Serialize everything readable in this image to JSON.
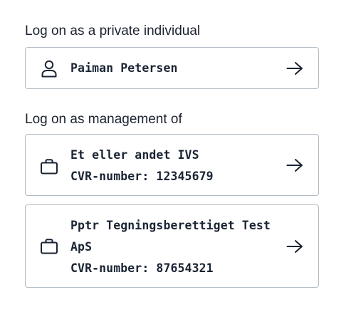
{
  "private_section": {
    "heading": "Log on as a private individual",
    "person": {
      "name": "Paiman Petersen",
      "icon": "person-icon"
    }
  },
  "management_section": {
    "heading": "Log on as management of",
    "companies": [
      {
        "name": "Et eller andet IVS",
        "cvr": "CVR-number: 12345679",
        "icon": "briefcase-icon"
      },
      {
        "name_line1": "Pptr Tegningsberettiget Test",
        "name_line2": "ApS",
        "cvr": "CVR-number: 87654321",
        "icon": "briefcase-icon"
      }
    ]
  },
  "colors": {
    "text": "#1a2433",
    "border": "#b4bcc4",
    "background": "#ffffff"
  }
}
